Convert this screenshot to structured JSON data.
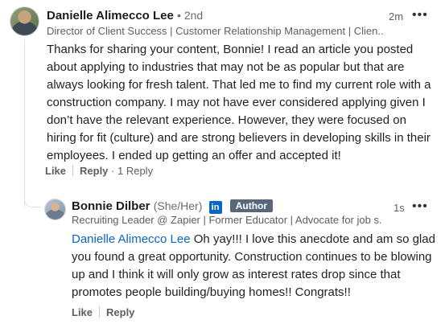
{
  "comment": {
    "author": "Danielle Alimecco Lee",
    "degree": "• 2nd",
    "headline": "Director of Client Success | Customer Relationship Management | Clien...",
    "time": "2m",
    "more": "•••",
    "body": "Thanks for sharing your content, Bonnie! I read an article you posted about applying to industries that may not be as popular but that are always looking for fresh talent. That led me to find my current role with a construction company. I may not have ever considered applying given I don’t have the relevant experience. However, they were focused on hiring for fit (culture) and are strong believers in developing skills in their employees. I ended up getting an offer and accepted it!",
    "like_label": "Like",
    "reply_label": "Reply",
    "reply_count": "· 1 Reply"
  },
  "reply": {
    "author": "Bonnie Dilber",
    "pronouns": "(She/Her)",
    "linkedin_icon": "in",
    "badge": "Author",
    "headline": "Recruiting Leader @ Zapier | Former Educator | Advocate for job s...",
    "time": "1s",
    "more": "•••",
    "mention": "Danielle Alimecco Lee",
    "body": " Oh yay!!! I love this anecdote and am so glad you found a great opportunity. Construction continues to be blowing up and I think it will only grow as interest rates drop since that promotes people building/buying homes!! Congrats!!",
    "like_label": "Like",
    "reply_label": "Reply"
  }
}
